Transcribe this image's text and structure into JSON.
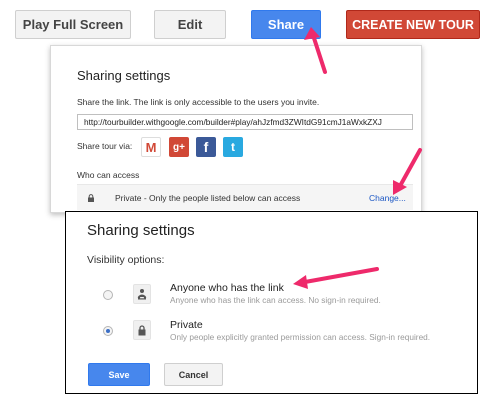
{
  "toolbar": {
    "play_label": "Play Full Screen",
    "edit_label": "Edit",
    "share_label": "Share",
    "create_label": "CREATE NEW TOUR"
  },
  "share_dialog": {
    "title": "Sharing settings",
    "description": "Share the link. The link is only accessible to the users you invite.",
    "link_value": "http://tourbuilder.withgoogle.com/builder#play/ahJzfmd3ZWItdG91cmJ1aWxkZXJ",
    "share_via_label": "Share tour via:",
    "social": [
      {
        "name": "gmail-icon",
        "glyph": "M"
      },
      {
        "name": "google-plus-icon",
        "glyph": "g+"
      },
      {
        "name": "facebook-icon",
        "glyph": "f"
      },
      {
        "name": "twitter-icon",
        "glyph": "t"
      }
    ],
    "who_label": "Who can access",
    "access_text": "Private - Only the people listed below can access",
    "change_label": "Change..."
  },
  "visibility_dialog": {
    "title": "Sharing settings",
    "visibility_label": "Visibility options:",
    "options": [
      {
        "title": "Anyone who has the link",
        "subtitle": "Anyone who has the link can access. No sign-in required.",
        "selected": false,
        "icon": "people-icon"
      },
      {
        "title": "Private",
        "subtitle": "Only people explicitly granted permission can access. Sign-in required.",
        "selected": true,
        "icon": "lock-icon"
      }
    ],
    "save_label": "Save",
    "cancel_label": "Cancel"
  },
  "colors": {
    "share_blue": "#4787ed",
    "create_red": "#d14836",
    "annotation_arrow": "#ee2a6b"
  }
}
